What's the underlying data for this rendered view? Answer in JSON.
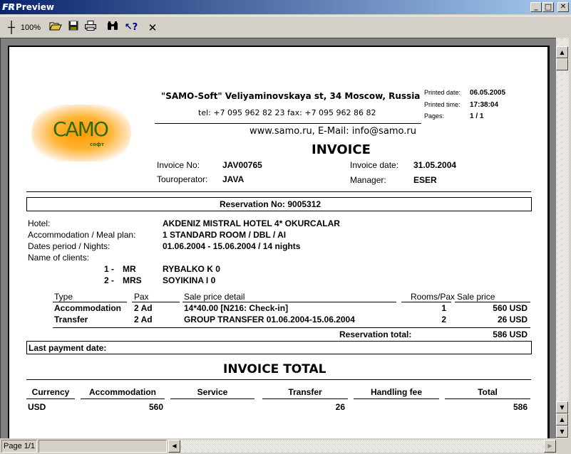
{
  "window": {
    "title": "Preview",
    "controls": {
      "minimize": "_",
      "maximize": "□",
      "close": "✕"
    }
  },
  "toolbar": {
    "zoom_icon": "┼",
    "zoom_level": "100%",
    "open_icon": "📂",
    "save_icon": "💾",
    "print_icon": "🖶",
    "find_icon": "🔍",
    "help_icon": "↖?",
    "close_icon": "✕"
  },
  "header": {
    "company_line": "\"SAMO-Soft\"  Veliyaminovskaya st, 34 Moscow, Russia",
    "phone_line": "tel: +7 095 962 82 23 fax: +7 095 962 86 82",
    "web_line": "www.samo.ru, E-Mail: info@samo.ru",
    "logo_text": "CAMO",
    "logo_sub": "софт",
    "printed_date_label": "Printed date:",
    "printed_date": "06.05.2005",
    "printed_time_label": "Printed time:",
    "printed_time": "17:38:04",
    "pages_label": "Pages:",
    "pages": "1 / 1"
  },
  "invoice": {
    "title": "INVOICE",
    "invoice_no_label": "Invoice No:",
    "invoice_no": "JAV00765",
    "invoice_date_label": "Invoice date:",
    "invoice_date": "31.05.2004",
    "touroperator_label": "Touroperator:",
    "touroperator": "JAVA",
    "manager_label": "Manager:",
    "manager": "ESER"
  },
  "reservation": {
    "title": "Reservation No: 9005312",
    "hotel_label": "Hotel:",
    "hotel": "AKDENIZ MISTRAL HOTEL 4* OKURCALAR",
    "accommodation_label": "Accommodation / Meal plan:",
    "accommodation": "1 STANDARD ROOM / DBL / AI",
    "dates_label": "Dates period / Nights:",
    "dates": "01.06.2004 - 15.06.2004 / 14 nights",
    "clients_label": "Name of clients:",
    "clients": [
      {
        "num": "1 -",
        "title": "MR",
        "name": "RYBALKO K 0"
      },
      {
        "num": "2 -",
        "title": "MRS",
        "name": "SOYIKINA I 0"
      }
    ]
  },
  "services": {
    "columns": [
      "Type",
      "Pax",
      "Sale price detail",
      "Rooms/Pax",
      "Sale price"
    ],
    "rows": [
      {
        "type": "Accommodation",
        "pax": "2 Ad",
        "detail": "14*40.00 [N216: Check-in]",
        "rooms": "1",
        "price": "560 USD"
      },
      {
        "type": "Transfer",
        "pax": "2 Ad",
        "detail": "GROUP TRANSFER 01.06.2004-15.06.2004",
        "rooms": "2",
        "price": "26 USD"
      }
    ],
    "total_label": "Reservation total:",
    "total": "586 USD"
  },
  "payment": {
    "last_payment_label": "Last payment date:"
  },
  "totals": {
    "title": "INVOICE TOTAL",
    "columns": [
      "Currency",
      "Accommodation",
      "Service",
      "Transfer",
      "Handling fee",
      "Total"
    ],
    "row": {
      "currency": "USD",
      "accommodation": "560",
      "service": "",
      "transfer": "26",
      "handling": "",
      "total": "586"
    }
  },
  "statusbar": {
    "page": "Page 1/1"
  },
  "scroll": {
    "up": "▲",
    "down": "▼",
    "page_up": "⇞",
    "page_down": "⇟",
    "left": "◀",
    "right": "▶"
  }
}
